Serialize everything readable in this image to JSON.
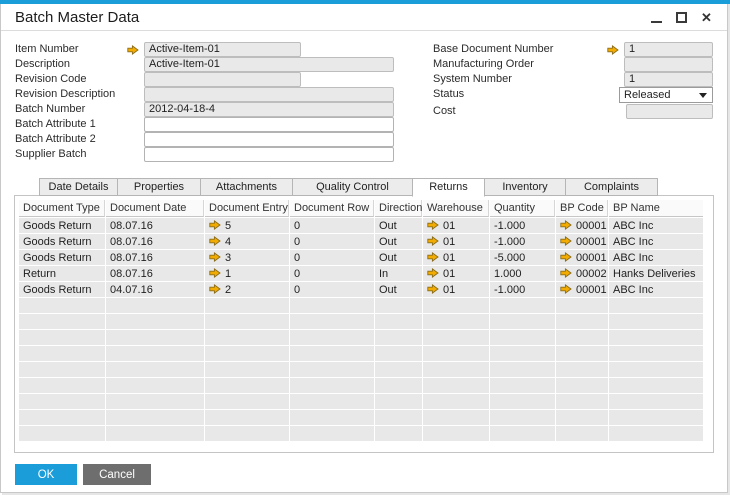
{
  "window": {
    "title": "Batch Master Data",
    "close_glyph": "✕"
  },
  "form": {
    "left": [
      {
        "label": "Item Number",
        "value": "Active-Item-01"
      },
      {
        "label": "Description",
        "value": "Active-Item-01"
      },
      {
        "label": "Revision Code",
        "value": ""
      },
      {
        "label": "Revision Description",
        "value": ""
      },
      {
        "label": "Batch Number",
        "value": "2012-04-18-4"
      },
      {
        "label": "Batch Attribute 1",
        "value": ""
      },
      {
        "label": "Batch Attribute 2",
        "value": ""
      },
      {
        "label": "Supplier Batch",
        "value": ""
      }
    ],
    "right": [
      {
        "label": "Base Document Number",
        "value": "1"
      },
      {
        "label": "Manufacturing Order",
        "value": ""
      },
      {
        "label": "System Number",
        "value": "1"
      },
      {
        "label": "Status",
        "value": "Released"
      },
      {
        "label": "Cost",
        "value": ""
      }
    ]
  },
  "tabs": [
    {
      "label": "Date Details"
    },
    {
      "label": "Properties"
    },
    {
      "label": "Attachments"
    },
    {
      "label": "Quality Control"
    },
    {
      "label": "Returns",
      "active": true
    },
    {
      "label": "Inventory"
    },
    {
      "label": "Complaints"
    }
  ],
  "table": {
    "columns": [
      "Document Type",
      "Document Date",
      "Document Entry",
      "Document Row",
      "Direction",
      "Warehouse",
      "Quantity",
      "BP Code",
      "BP Name"
    ],
    "arrow_columns": [
      2,
      5,
      7
    ],
    "rows": [
      {
        "cells": [
          "Goods Return",
          "08.07.16",
          "5",
          "0",
          "Out",
          "01",
          "-1.000",
          "00001",
          "ABC Inc"
        ]
      },
      {
        "cells": [
          "Goods Return",
          "08.07.16",
          "4",
          "0",
          "Out",
          "01",
          "-1.000",
          "00001",
          "ABC Inc"
        ]
      },
      {
        "cells": [
          "Goods Return",
          "08.07.16",
          "3",
          "0",
          "Out",
          "01",
          "-5.000",
          "00001",
          "ABC Inc"
        ]
      },
      {
        "cells": [
          "Return",
          "08.07.16",
          "1",
          "0",
          "In",
          "01",
          "1.000",
          "00002",
          "Hanks Deliveries"
        ]
      },
      {
        "cells": [
          "Goods Return",
          "04.07.16",
          "2",
          "0",
          "Out",
          "01",
          "-1.000",
          "00001",
          "ABC Inc"
        ]
      }
    ],
    "empty_row_count": 9
  },
  "footer": {
    "ok": "OK",
    "cancel": "Cancel"
  },
  "icons": {
    "link_arrow": "link-arrow-icon",
    "dropdown_caret": "chevron-down-icon",
    "minimize": "minimize-icon",
    "maximize": "maximize-icon",
    "close": "close-icon"
  },
  "colors": {
    "accent_blue": "#1b9dd9",
    "link_arrow_fill": "#F2AB00",
    "ok_button": "#1b9dd9",
    "cancel_button": "#6e6e6e",
    "disabled_field": "#e9e9e9",
    "table_cell": "#e8e8e8"
  }
}
